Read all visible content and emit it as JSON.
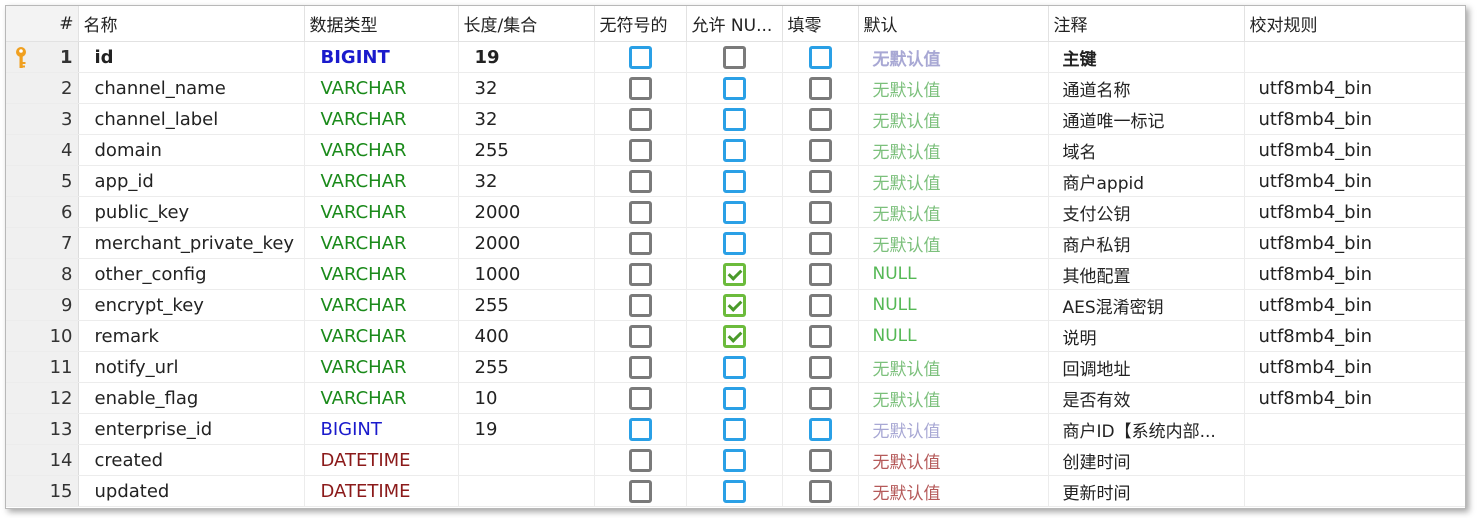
{
  "colors": {
    "bigint": "#1a1acc",
    "varchar": "#1a8a1a",
    "datetime": "#8b1a1a",
    "checkbox_blue": "#2aa0e6",
    "checkbox_gray": "#7a7a7a",
    "checkbox_checked": "#6cbb3c",
    "key_icon": "#f0a020"
  },
  "headers": {
    "num": "#",
    "name": "名称",
    "type": "数据类型",
    "length": "长度/集合",
    "unsigned": "无符号的",
    "allow_null": "允许 NU...",
    "zerofill": "填零",
    "default": "默认",
    "comment": "注释",
    "collation": "校对规则"
  },
  "rows": [
    {
      "num": "1",
      "name": "id",
      "type": "BIGINT",
      "type_class": "bigint",
      "length": "19",
      "unsigned": "blue",
      "allow_null": "gray",
      "zerofill": "blue",
      "default": "无默认值",
      "default_class": "purple",
      "comment": "主键",
      "collation": "",
      "primary_key": true,
      "icon": "key-icon"
    },
    {
      "num": "2",
      "name": "channel_name",
      "type": "VARCHAR",
      "type_class": "varchar",
      "length": "32",
      "unsigned": "gray",
      "allow_null": "blue",
      "zerofill": "gray",
      "default": "无默认值",
      "default_class": "green",
      "comment": "通道名称",
      "collation": "utf8mb4_bin"
    },
    {
      "num": "3",
      "name": "channel_label",
      "type": "VARCHAR",
      "type_class": "varchar",
      "length": "32",
      "unsigned": "gray",
      "allow_null": "blue",
      "zerofill": "gray",
      "default": "无默认值",
      "default_class": "green",
      "comment": "通道唯一标记",
      "collation": "utf8mb4_bin"
    },
    {
      "num": "4",
      "name": "domain",
      "type": "VARCHAR",
      "type_class": "varchar",
      "length": "255",
      "unsigned": "gray",
      "allow_null": "blue",
      "zerofill": "gray",
      "default": "无默认值",
      "default_class": "green",
      "comment": "域名",
      "collation": "utf8mb4_bin"
    },
    {
      "num": "5",
      "name": "app_id",
      "type": "VARCHAR",
      "type_class": "varchar",
      "length": "32",
      "unsigned": "gray",
      "allow_null": "blue",
      "zerofill": "gray",
      "default": "无默认值",
      "default_class": "green",
      "comment": "商户appid",
      "collation": "utf8mb4_bin"
    },
    {
      "num": "6",
      "name": "public_key",
      "type": "VARCHAR",
      "type_class": "varchar",
      "length": "2000",
      "unsigned": "gray",
      "allow_null": "blue",
      "zerofill": "gray",
      "default": "无默认值",
      "default_class": "green",
      "comment": "支付公钥",
      "collation": "utf8mb4_bin"
    },
    {
      "num": "7",
      "name": "merchant_private_key",
      "type": "VARCHAR",
      "type_class": "varchar",
      "length": "2000",
      "unsigned": "gray",
      "allow_null": "blue",
      "zerofill": "gray",
      "default": "无默认值",
      "default_class": "green",
      "comment": "商户私钥",
      "collation": "utf8mb4_bin"
    },
    {
      "num": "8",
      "name": "other_config",
      "type": "VARCHAR",
      "type_class": "varchar",
      "length": "1000",
      "unsigned": "gray",
      "allow_null": "checked",
      "zerofill": "gray",
      "default": "NULL",
      "default_class": "null",
      "comment": "其他配置",
      "collation": "utf8mb4_bin"
    },
    {
      "num": "9",
      "name": "encrypt_key",
      "type": "VARCHAR",
      "type_class": "varchar",
      "length": "255",
      "unsigned": "gray",
      "allow_null": "checked",
      "zerofill": "gray",
      "default": "NULL",
      "default_class": "null",
      "comment": "AES混淆密钥",
      "collation": "utf8mb4_bin"
    },
    {
      "num": "10",
      "name": "remark",
      "type": "VARCHAR",
      "type_class": "varchar",
      "length": "400",
      "unsigned": "gray",
      "allow_null": "checked",
      "zerofill": "gray",
      "default": "NULL",
      "default_class": "null",
      "comment": "说明",
      "collation": "utf8mb4_bin"
    },
    {
      "num": "11",
      "name": "notify_url",
      "type": "VARCHAR",
      "type_class": "varchar",
      "length": "255",
      "unsigned": "gray",
      "allow_null": "blue",
      "zerofill": "gray",
      "default": "无默认值",
      "default_class": "green",
      "comment": "回调地址",
      "collation": "utf8mb4_bin"
    },
    {
      "num": "12",
      "name": "enable_flag",
      "type": "VARCHAR",
      "type_class": "varchar",
      "length": "10",
      "unsigned": "gray",
      "allow_null": "blue",
      "zerofill": "gray",
      "default": "无默认值",
      "default_class": "green",
      "comment": "是否有效",
      "collation": "utf8mb4_bin"
    },
    {
      "num": "13",
      "name": "enterprise_id",
      "type": "BIGINT",
      "type_class": "bigint",
      "length": "19",
      "unsigned": "blue",
      "allow_null": "blue",
      "zerofill": "blue",
      "default": "无默认值",
      "default_class": "purple",
      "comment": "商户ID【系统内部...",
      "collation": ""
    },
    {
      "num": "14",
      "name": "created",
      "type": "DATETIME",
      "type_class": "datetime",
      "length": "",
      "unsigned": "gray",
      "allow_null": "blue",
      "zerofill": "gray",
      "default": "无默认值",
      "default_class": "red",
      "comment": "创建时间",
      "collation": ""
    },
    {
      "num": "15",
      "name": "updated",
      "type": "DATETIME",
      "type_class": "datetime",
      "length": "",
      "unsigned": "gray",
      "allow_null": "blue",
      "zerofill": "gray",
      "default": "无默认值",
      "default_class": "red",
      "comment": "更新时间",
      "collation": ""
    }
  ]
}
